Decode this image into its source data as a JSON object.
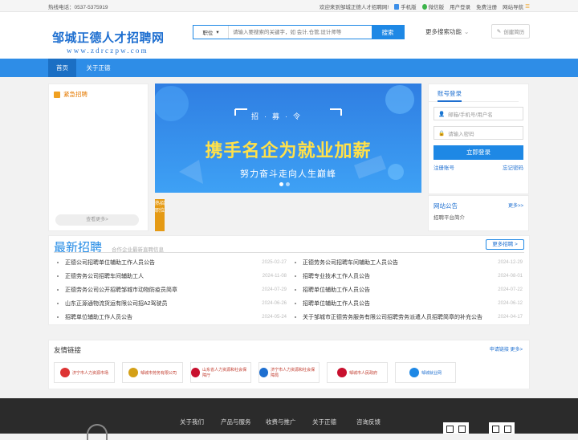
{
  "topbar": {
    "hotline": "热线电话：0537-5375919",
    "welcome": "欢迎来到邹城正德人才招聘网!",
    "links": [
      "手机版",
      "微信版",
      "用户登录",
      "免费注册",
      "网站导航"
    ]
  },
  "header": {
    "logo_cn": "邹城正德人才招聘网",
    "logo_en": "www.zdrczpw.com",
    "search_type": "职位",
    "search_placeholder": "请输入要搜索的关键字，如 会计,仓管,设计师等",
    "search_button": "搜索",
    "more_search": "更多搜索功能",
    "create_resume": "创建简历"
  },
  "nav": {
    "home": "首页",
    "about": "关于正德"
  },
  "urgent": {
    "title": "紧急招聘",
    "view_more": "查看更多>"
  },
  "banner": {
    "top": "招·募·令",
    "headline": "携手名企为就业加薪",
    "sub": "努力奋斗走向人生巅峰"
  },
  "hot_job": "热招职位",
  "login": {
    "tab": "账号登录",
    "user_placeholder": "邮箱/手机号/用户名",
    "pass_placeholder": "请输入密码",
    "login_button": "立即登录",
    "register": "注册账号",
    "forgot": "忘记密码"
  },
  "notice": {
    "title": "网站公告",
    "more": "更多>>",
    "items": [
      "招聘平台简介"
    ]
  },
  "latest": {
    "title": "最新招聘",
    "subtitle": "合作企业最新直聘信息",
    "more": "更多招聘 >",
    "left": [
      {
        "t": "正德公司招聘单位辅助工作人员公告",
        "d": "2025-02-27"
      },
      {
        "t": "正德劳务公司招聘车间辅助工人",
        "d": "2024-11-08"
      },
      {
        "t": "正德劳务公司公开招聘邹城市动物防疫员简章",
        "d": "2024-07-29"
      },
      {
        "t": "山东正源通物流货运有限公司招A2驾驶员",
        "d": "2024-06-26"
      },
      {
        "t": "招聘单位辅助工作人员公告",
        "d": "2024-05-24"
      }
    ],
    "right": [
      {
        "t": "正德劳务公司招聘车间辅助工人员公告",
        "d": "2024-12-29"
      },
      {
        "t": "招聘专业技术工作人员公告",
        "d": "2024-08-01"
      },
      {
        "t": "招聘单位辅助工作人员公告",
        "d": "2024-07-22"
      },
      {
        "t": "招聘单位辅助工作人员公告",
        "d": "2024-06-12"
      },
      {
        "t": "关于邹城市正德劳务服务有限公司招聘劳务派遣人员招聘简章的补充公告",
        "d": "2024-04-17"
      }
    ]
  },
  "links": {
    "title": "友情链接",
    "more": "申请链接 更多>",
    "items": [
      "济宁市人力资源市场",
      "邹城市劳务有限公司",
      "山东省人力资源和社会保障厅",
      "济宁市人力资源和社会保障局",
      "邹城市人民政府",
      "邹城就业网"
    ]
  },
  "footer": {
    "links": [
      "关于我们",
      "产品与服务",
      "收费与推广",
      "关于正德",
      "咨询反馈"
    ]
  },
  "colors": {
    "primary": "#1e88e5",
    "nav": "#2e8de7",
    "urgent": "#e57a00",
    "banner_text": "#ffe14a"
  }
}
